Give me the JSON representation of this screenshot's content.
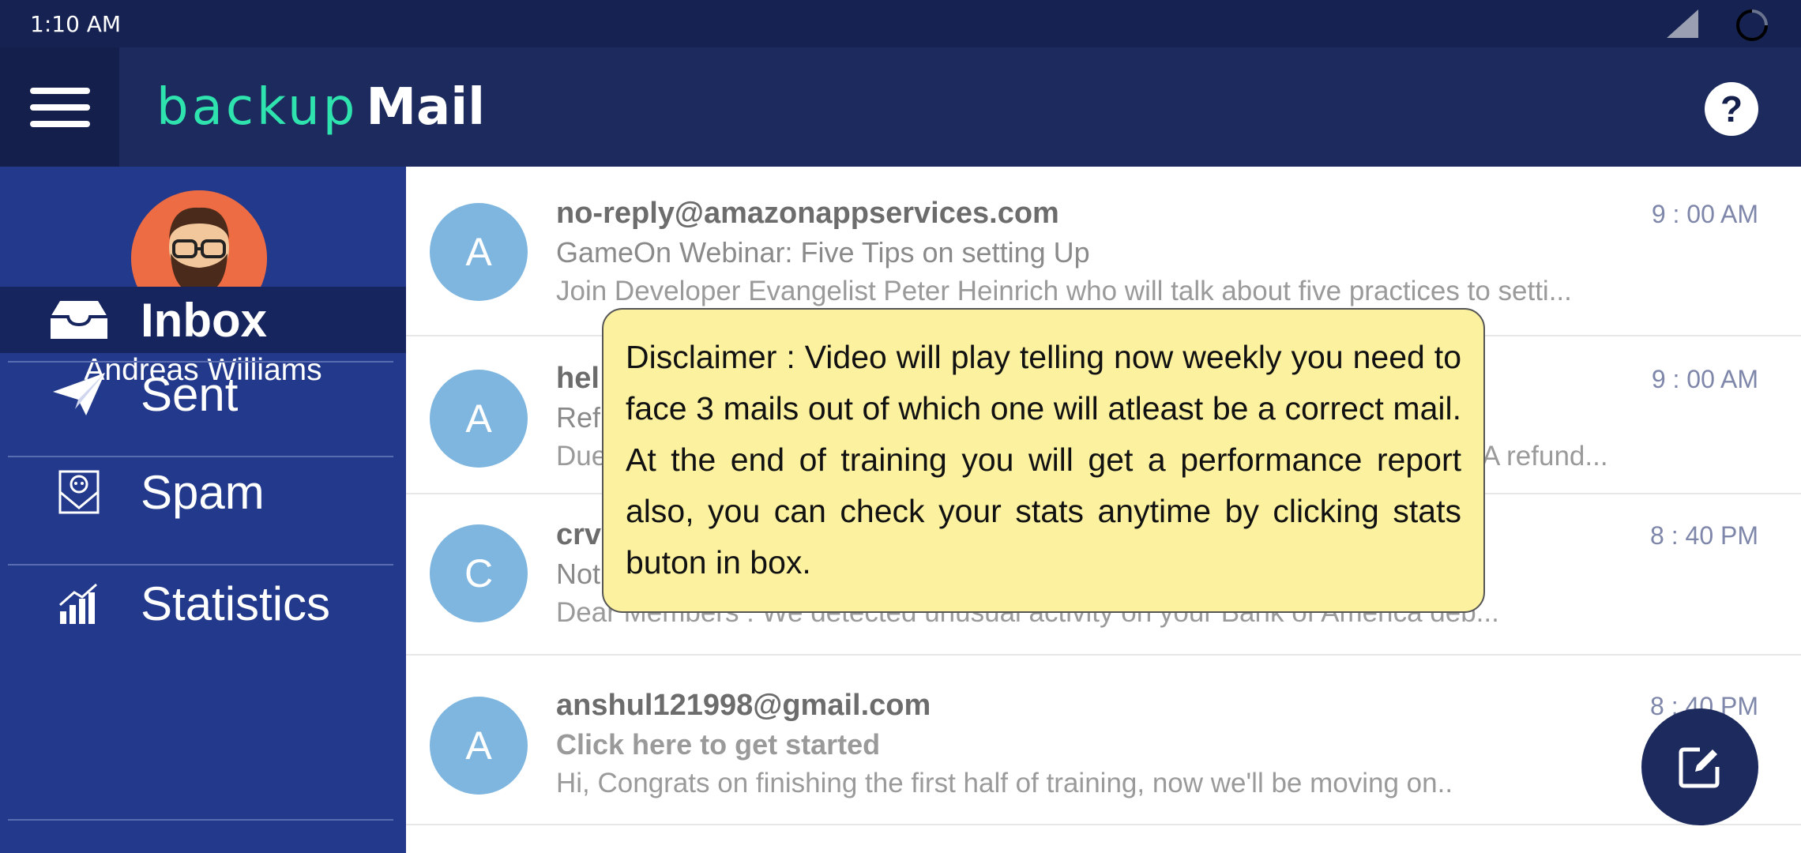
{
  "status_bar": {
    "time": "1:10 AM"
  },
  "app_bar": {
    "logo_part1": "backup",
    "logo_part2": "Mail",
    "help_label": "?"
  },
  "sidebar": {
    "user_name": "Andreas Williams",
    "items": [
      {
        "label": "Inbox",
        "icon": "inbox-icon",
        "active": true
      },
      {
        "label": "Sent",
        "icon": "paper-plane-icon",
        "active": false
      },
      {
        "label": "Spam",
        "icon": "spam-envelope-icon",
        "active": false
      },
      {
        "label": "Statistics",
        "icon": "bar-chart-icon",
        "active": false
      }
    ]
  },
  "mails": [
    {
      "initial": "A",
      "from": "no-reply@amazonappservices.com",
      "subject": "GameOn Webinar: Five Tips on setting Up",
      "preview": "Join Developer Evangelist Peter Heinrich who will talk about five practices to setti...",
      "time": "9 : 00 AM"
    },
    {
      "initial": "A",
      "from": "hel",
      "subject": "Ref",
      "preview": "Due",
      "preview_tail": "A refund...",
      "time": "9 : 00 AM"
    },
    {
      "initial": "C",
      "from": "crv",
      "subject": "Not",
      "preview": "Dear Members : We detected unusual activity on your Bank of America deb...",
      "time": "8 : 40 PM"
    },
    {
      "initial": "A",
      "from": "anshul121998@gmail.com",
      "subject": "Click here to get started",
      "preview": "Hi, Congrats on finishing the first half of training, now we'll be moving on..",
      "time": "8 : 40 PM"
    }
  ],
  "disclaimer": {
    "text": "Disclaimer : Video will play telling now weekly you need to face 3 mails out of which one will atleast be a correct mail. At the end of training you will get a performance report also, you can check your stats anytime by clicking stats buton in box."
  },
  "fab": {
    "icon": "compose-icon"
  },
  "colors": {
    "status_bar": "#162352",
    "app_bar": "#1c2a5e",
    "sidebar": "#233a8c",
    "logo_accent": "#2fe3ae",
    "avatar_circle": "#7fb6df",
    "disclaimer_bg": "#fbf19f"
  }
}
